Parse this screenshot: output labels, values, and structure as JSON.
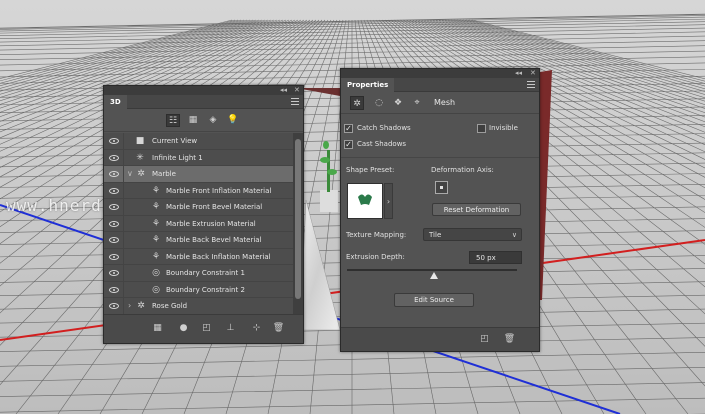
{
  "watermark": "www.hnerdianshoji.com",
  "panel3d": {
    "tab": "3D",
    "filters": [
      "scene-filter-icon",
      "mesh-filter-icon",
      "material-filter-icon",
      "light-filter-icon"
    ],
    "layers": [
      {
        "label": "Current View",
        "icon": "camera-icon",
        "indent": 0
      },
      {
        "label": "Infinite Light 1",
        "icon": "light-icon",
        "indent": 0
      },
      {
        "label": "Marble",
        "icon": "mesh-icon",
        "indent": 0,
        "expanded": true,
        "selected": true
      },
      {
        "label": "Marble Front Inflation Material",
        "icon": "material-icon",
        "indent": 1
      },
      {
        "label": "Marble Front Bevel Material",
        "icon": "material-icon",
        "indent": 1
      },
      {
        "label": "Marble Extrusion Material",
        "icon": "material-icon",
        "indent": 1
      },
      {
        "label": "Marble Back Bevel Material",
        "icon": "material-icon",
        "indent": 1
      },
      {
        "label": "Marble Back Inflation Material",
        "icon": "material-icon",
        "indent": 1
      },
      {
        "label": "Boundary Constraint 1",
        "icon": "constraint-icon",
        "indent": 1
      },
      {
        "label": "Boundary Constraint 2",
        "icon": "constraint-icon",
        "indent": 1
      },
      {
        "label": "Rose Gold",
        "icon": "mesh-icon",
        "indent": 0,
        "collapsed": true
      }
    ]
  },
  "properties": {
    "tab": "Properties",
    "mesh_label": "Mesh",
    "catch_shadows": "Catch Shadows",
    "cast_shadows": "Cast Shadows",
    "invisible": "Invisible",
    "shape_preset": "Shape Preset:",
    "deformation_axis": "Deformation Axis:",
    "reset_deformation": "Reset Deformation",
    "texture_mapping_label": "Texture Mapping:",
    "texture_mapping_value": "Tile",
    "extrusion_depth_label": "Extrusion Depth:",
    "extrusion_depth_value": "50 px",
    "extrusion_slider": 0.51,
    "edit_source": "Edit Source"
  }
}
